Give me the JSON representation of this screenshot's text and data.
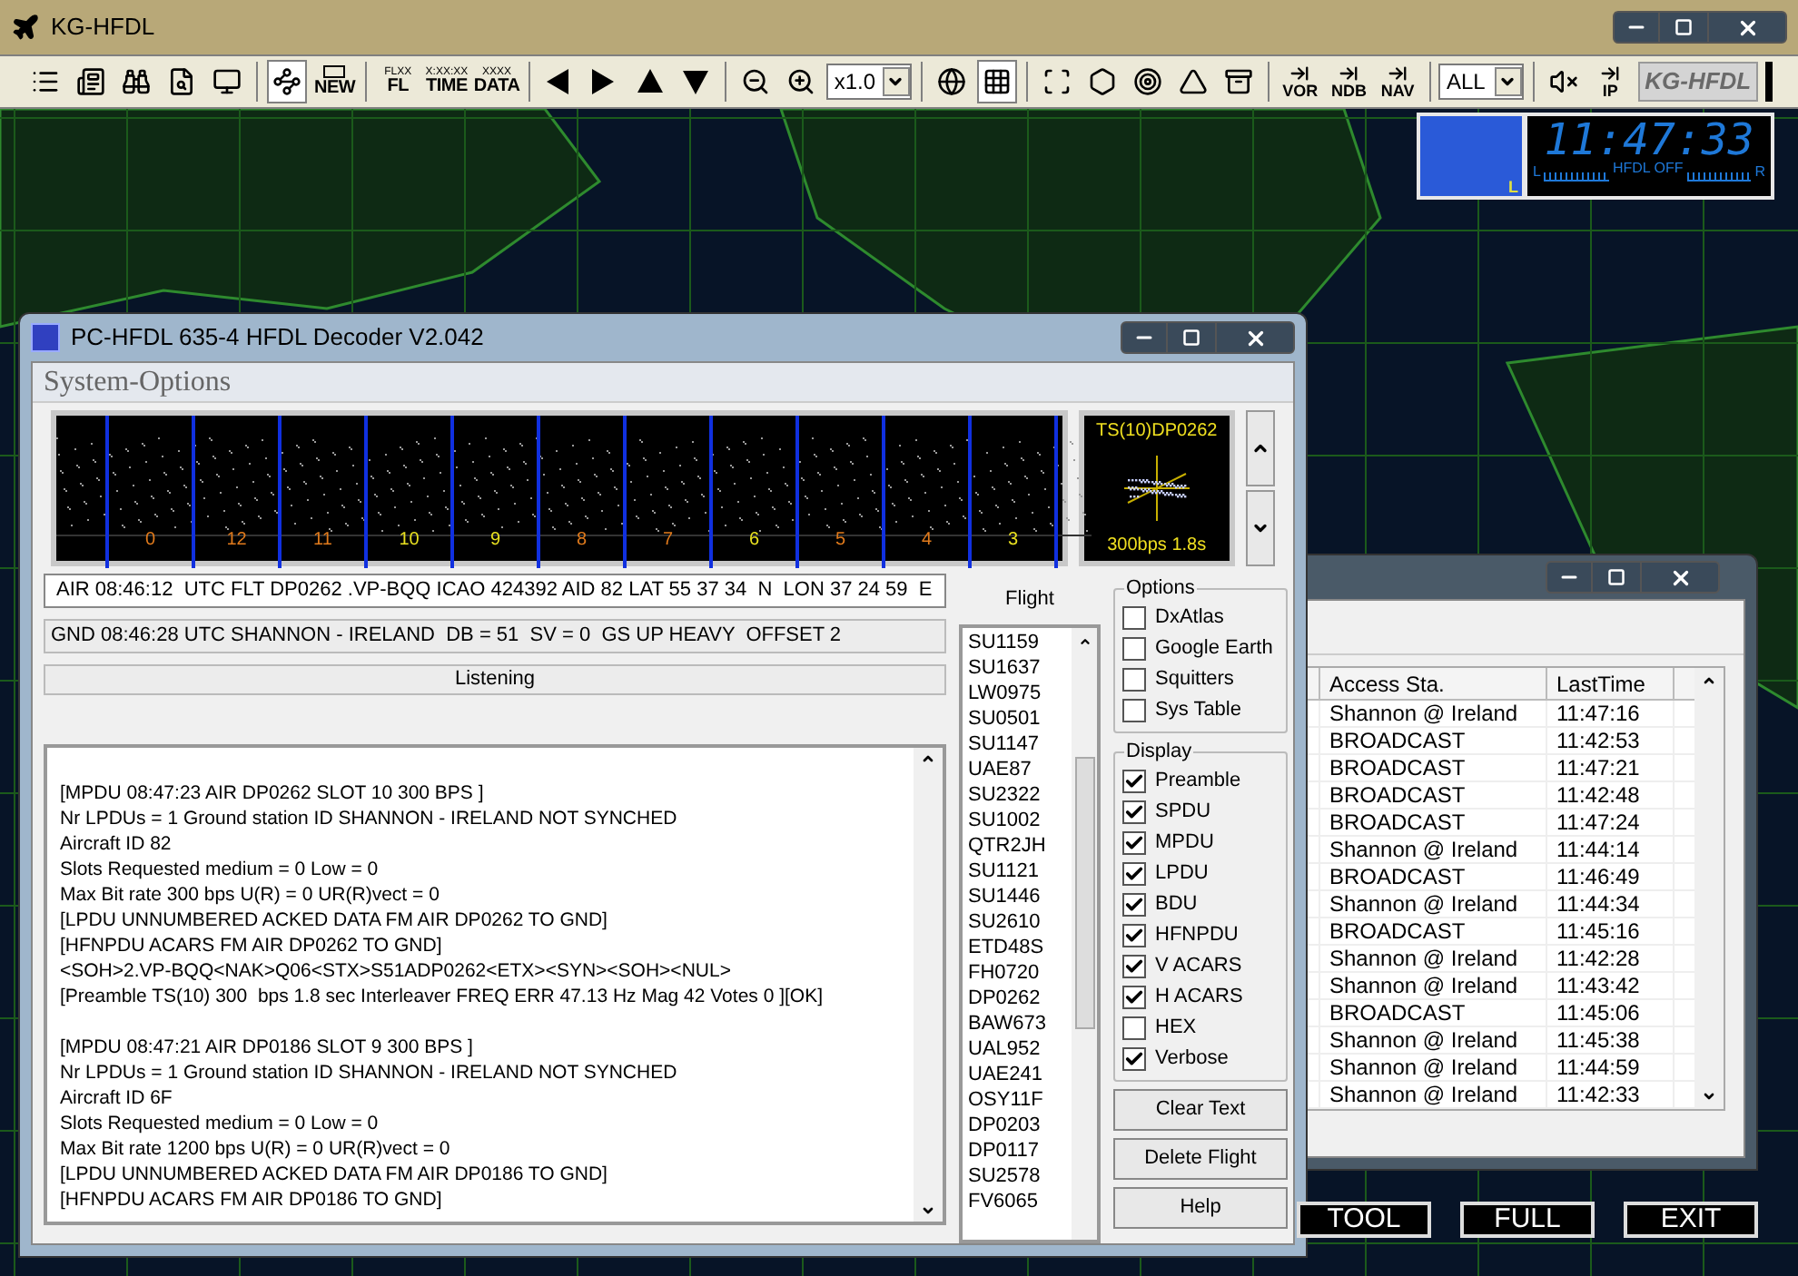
{
  "app": {
    "title": "KG-HFDL"
  },
  "toolbar": [
    {
      "kind": "icon",
      "pressed": false
    },
    {
      "kind": "icon",
      "pressed": false
    },
    {
      "kind": "icon",
      "pressed": false
    },
    {
      "kind": "icon",
      "pressed": false
    },
    {
      "kind": "icon",
      "pressed": false
    },
    {
      "kind": "separator"
    },
    {
      "kind": "icon",
      "pressed": true
    },
    {
      "kind": "text",
      "label": "NEW"
    },
    {
      "kind": "separator"
    },
    {
      "kind": "text",
      "small": "FLXX",
      "label": "FL"
    },
    {
      "kind": "text",
      "small": "X:XX:XX",
      "label": "TIME"
    },
    {
      "kind": "text",
      "small": "XXXX",
      "label": "DATA"
    },
    {
      "kind": "separator"
    },
    {
      "kind": "icon",
      "pressed": false
    },
    {
      "kind": "icon",
      "pressed": false
    },
    {
      "kind": "icon",
      "pressed": false
    },
    {
      "kind": "icon",
      "pressed": false
    },
    {
      "kind": "separator"
    },
    {
      "kind": "icon",
      "pressed": false
    },
    {
      "kind": "icon",
      "pressed": false
    },
    {
      "kind": "select",
      "value": "x1.0"
    },
    {
      "kind": "separator"
    },
    {
      "kind": "icon",
      "pressed": false
    },
    {
      "kind": "icon",
      "pressed": true
    },
    {
      "kind": "separator"
    },
    {
      "kind": "icon",
      "pressed": false
    },
    {
      "kind": "icon",
      "pressed": false
    },
    {
      "kind": "icon",
      "pressed": false
    },
    {
      "kind": "icon",
      "pressed": false
    },
    {
      "kind": "icon",
      "pressed": false
    },
    {
      "kind": "separator"
    },
    {
      "kind": "arrow_text",
      "label": "VOR"
    },
    {
      "kind": "arrow_text",
      "label": "NDB"
    },
    {
      "kind": "arrow_text",
      "label": "NAV"
    },
    {
      "kind": "separator"
    },
    {
      "kind": "select",
      "value": "ALL"
    },
    {
      "kind": "separator"
    },
    {
      "kind": "icon",
      "pressed": false
    },
    {
      "kind": "arrow_text",
      "label": "IP"
    },
    {
      "kind": "logo",
      "label": "KG-HFDL"
    }
  ],
  "clock": {
    "spectrum_label": "L",
    "time": "11:47:33",
    "status": "HFDL OFF",
    "left": "L",
    "right": "R"
  },
  "decoder": {
    "title": "PC-HFDL 635-4 HFDL Decoder V2.042",
    "section": "System-Options",
    "slots": [
      {
        "label": "0",
        "color": "#e07a1c"
      },
      {
        "label": "12",
        "color": "#e07a1c"
      },
      {
        "label": "11",
        "color": "#e07a1c"
      },
      {
        "label": "10",
        "color": "#e8e020"
      },
      {
        "label": "9",
        "color": "#e8e020"
      },
      {
        "label": "8",
        "color": "#e07a1c"
      },
      {
        "label": "7",
        "color": "#e07a1c"
      },
      {
        "label": "6",
        "color": "#e8e020"
      },
      {
        "label": "5",
        "color": "#e07a1c"
      },
      {
        "label": "4",
        "color": "#e07a1c"
      },
      {
        "label": "3",
        "color": "#e8e020"
      }
    ],
    "constellation": {
      "title": "TS(10)DP0262",
      "footer": "300bps 1.8s"
    },
    "air_line": "AIR 08:46:12  UTC FLT DP0262 .VP-BQQ ICAO 424392 AID 82 LAT 55 37 34  N  LON 37 24 59  E",
    "gnd_line": "GND 08:46:28 UTC SHANNON - IRELAND  DB = 51  SV = 0  GS UP HEAVY  OFFSET 2",
    "status": "Listening",
    "log": [
      [
        "[MPDU 08:47:23 AIR DP0262 SLOT 10 300 BPS ]",
        "Nr LPDUs = 1 Ground station ID SHANNON - IRELAND NOT SYNCHED",
        "Aircraft ID 82",
        "Slots Requested medium = 0 Low = 0",
        "Max Bit rate 300 bps U(R) = 0 UR(R)vect = 0",
        "[LPDU UNNUMBERED ACKED DATA FM AIR DP0262 TO GND]",
        "[HFNPDU ACARS FM AIR DP0262 TO GND]",
        "<SOH>2.VP-BQQ<NAK>Q06<STX>S51ADP0262<ETX><SYN><SOH><NUL>",
        "[Preamble TS(10) 300  bps 1.8 sec Interleaver FREQ ERR 47.13 Hz Mag 42 Votes 0 ][OK]"
      ],
      [
        "[MPDU 08:47:21 AIR DP0186 SLOT 9 300 BPS ]",
        "Nr LPDUs = 1 Ground station ID SHANNON - IRELAND NOT SYNCHED",
        "Aircraft ID 6F",
        "Slots Requested medium = 0 Low = 0",
        "Max Bit rate 1200 bps U(R) = 0 UR(R)vect = 0",
        "[LPDU UNNUMBERED ACKED DATA FM AIR DP0186 TO GND]",
        "[HFNPDU ACARS FM AIR DP0186 TO GND]"
      ]
    ],
    "flight_header": "Flight",
    "flights": [
      "SU1159",
      "SU1637",
      "LW0975",
      "SU0501",
      "SU1147",
      "UAE87",
      "SU2322",
      "SU1002",
      "QTR2JH",
      "SU1121",
      "SU1446",
      "SU2610",
      "ETD48S",
      "FH0720",
      "DP0262",
      "BAW673",
      "UAL952",
      "UAE241",
      "OSY11F",
      "DP0203",
      "DP0117",
      "SU2578",
      "FV6065"
    ],
    "options": {
      "title": "Options",
      "items": [
        {
          "label": "DxAtlas",
          "checked": false
        },
        {
          "label": "Google Earth",
          "checked": false
        },
        {
          "label": "Squitters",
          "checked": false
        },
        {
          "label": "Sys Table",
          "checked": false
        }
      ]
    },
    "display": {
      "title": "Display",
      "items": [
        {
          "label": "Preamble",
          "checked": true
        },
        {
          "label": "SPDU",
          "checked": true
        },
        {
          "label": "MPDU",
          "checked": true
        },
        {
          "label": "LPDU",
          "checked": true
        },
        {
          "label": "BDU",
          "checked": true
        },
        {
          "label": "HFNPDU",
          "checked": true
        },
        {
          "label": "V ACARS",
          "checked": true
        },
        {
          "label": "H ACARS",
          "checked": true
        },
        {
          "label": "HEX",
          "checked": false
        },
        {
          "label": "Verbose",
          "checked": true
        }
      ]
    },
    "buttons": [
      "Clear Text",
      "Delete Flight",
      "Help"
    ]
  },
  "stations": {
    "columns": [
      "Access Sta.",
      "LastTime"
    ],
    "rows": [
      [
        "Shannon @ Ireland",
        "11:47:16"
      ],
      [
        "BROADCAST",
        "11:42:53"
      ],
      [
        "BROADCAST",
        "11:47:21"
      ],
      [
        "BROADCAST",
        "11:42:48"
      ],
      [
        "BROADCAST",
        "11:47:24"
      ],
      [
        "Shannon @ Ireland",
        "11:44:14"
      ],
      [
        "BROADCAST",
        "11:46:49"
      ],
      [
        "Shannon @ Ireland",
        "11:44:34"
      ],
      [
        "BROADCAST",
        "11:45:16"
      ],
      [
        "Shannon @ Ireland",
        "11:42:28"
      ],
      [
        "Shannon @ Ireland",
        "11:43:42"
      ],
      [
        "BROADCAST",
        "11:45:06"
      ],
      [
        "Shannon @ Ireland",
        "11:45:38"
      ],
      [
        "Shannon @ Ireland",
        "11:44:59"
      ],
      [
        "Shannon @ Ireland",
        "11:42:33"
      ]
    ]
  },
  "bottom_buttons": [
    "TOOL",
    "FULL",
    "EXIT"
  ]
}
